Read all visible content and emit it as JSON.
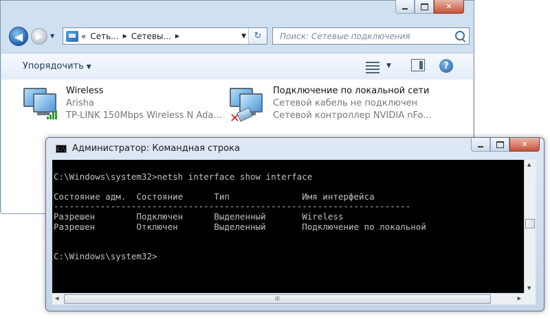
{
  "explorer": {
    "address": {
      "overflow": "«",
      "crumbs": [
        "Сеть...",
        "Сетевы..."
      ]
    },
    "search": {
      "placeholder": "Поиск: Сетевые подключения"
    },
    "toolbar": {
      "organize_label": "Упорядочить"
    },
    "connections": [
      {
        "name": "Wireless",
        "status": "Arisha",
        "device": "TP-LINK 150Mbps Wireless N Ada..."
      },
      {
        "name": "Подключение по локальной сети",
        "status": "Сетевой кабель не подключен",
        "device": "Сетевой контроллер NVIDIA nFo..."
      }
    ]
  },
  "cmd": {
    "title": "Администратор: Командная строка",
    "icon_text": "C:\\",
    "lines": [
      "",
      "C:\\Windows\\system32>netsh interface show interface",
      "",
      "Состояние адм.  Состояние      Тип              Имя интерфейса",
      "---------------------------------------------------------------------",
      "Разрешен        Подключен      Выделенный       Wireless",
      "Разрешен        Отключен       Выделенный       Подключение по локальной",
      "",
      "",
      "C:\\Windows\\system32>"
    ],
    "hscroll_grip": "III"
  },
  "icons": {
    "back": "◀",
    "forward": "▶",
    "refresh": "↻"
  },
  "colors": {
    "console_bg": "#000000",
    "console_fg": "#c0c0c0",
    "close_button": "#c75139",
    "window_frame": "#cfe0f1"
  }
}
